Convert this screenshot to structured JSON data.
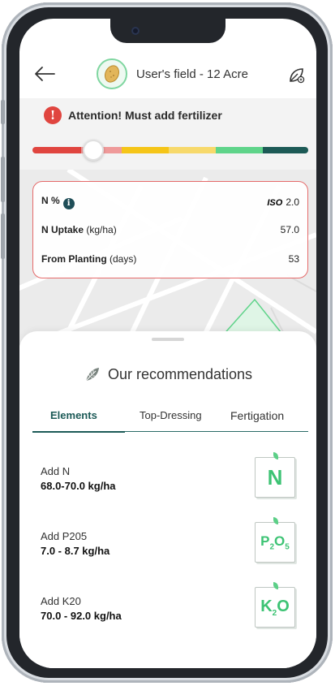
{
  "header": {
    "field_title": "User's field - 12 Acre",
    "back_icon": "arrow-left-icon",
    "crop_icon": "potato-icon",
    "edit_icon": "leaf-edit-icon"
  },
  "alert": {
    "text": "Attention! Must add fertilizer",
    "icon": "alert-circle-icon"
  },
  "scale": {
    "segments": [
      "#e0453f",
      "#ef9a9a",
      "#f5c518",
      "#f7d96b",
      "#5fd48a",
      "#1d5a56"
    ],
    "knob_level": 0.22
  },
  "info": {
    "rows": [
      {
        "label": "N %",
        "value": "2.0",
        "badge": "ISO"
      },
      {
        "label_bold": "N Uptake",
        "label_unit": " (kg/ha)",
        "value": "57.0"
      },
      {
        "label_bold": "From Planting",
        "label_unit": " (days)",
        "value": "53"
      }
    ]
  },
  "recommendations": {
    "title": "Our recommendations",
    "title_icon": "feather-leaf-icon",
    "tabs": [
      "Elements",
      "Top-Dressing",
      "Fertigation"
    ],
    "active_tab": 0,
    "items": [
      {
        "label": "Add N",
        "value": "68.0-70.0 kg/ha",
        "symbol": "N",
        "sub": ""
      },
      {
        "label": "Add P205",
        "value": "7.0 - 8.7 kg/ha",
        "symbol_parts": [
          "P",
          "2",
          "O",
          "5"
        ]
      },
      {
        "label": "Add K20",
        "value": "70.0 - 92.0 kg/ha",
        "symbol_parts": [
          "K",
          "2",
          "O"
        ]
      }
    ]
  },
  "colors": {
    "accent": "#1c5a57",
    "alert": "#e0453f",
    "chip_green": "#3dc374"
  }
}
